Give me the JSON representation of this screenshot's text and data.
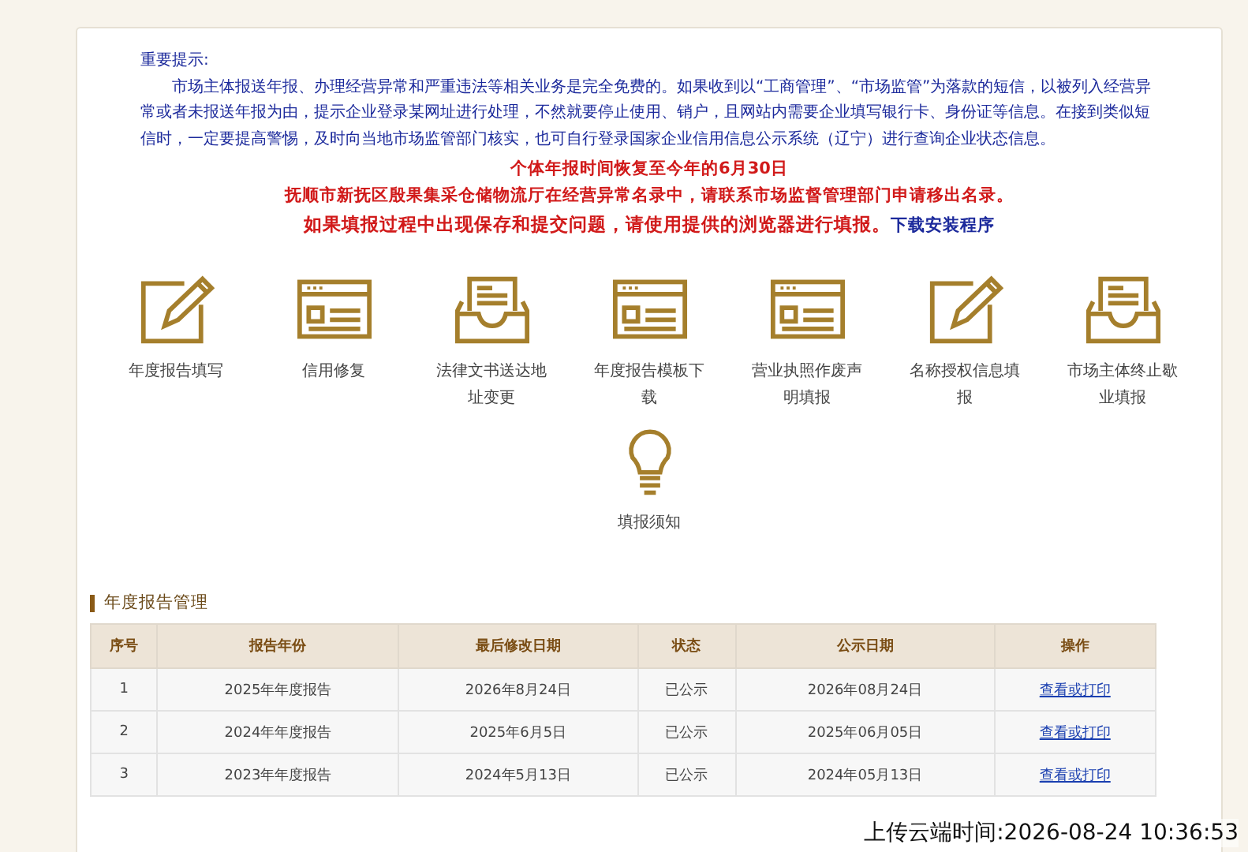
{
  "notice": {
    "heading": "重要提示:",
    "body": "市场主体报送年报、办理经营异常和严重违法等相关业务是完全免费的。如果收到以“工商管理”、“市场监管”为落款的短信，以被列入经营异常或者未报送年报为由，提示企业登录某网址进行处理，不然就要停止使用、销户，且网站内需要企业填写银行卡、身份证等信息。在接到类似短信时，一定要提高警惕，及时向当地市场监管部门核实，也可自行登录国家企业信用信息公示系统（辽宁）进行查询企业状态信息。",
    "alerts": [
      "个体年报时间恢复至今年的6月30日",
      "抚顺市新抚区殷果集采仓储物流厅在经营异常名录中，请联系市场监督管理部门申请移出名录。"
    ],
    "browser_tip": "如果填报过程中出现保存和提交问题，请使用提供的浏览器进行填报。",
    "download_link": "下载安装程序"
  },
  "services": [
    {
      "kind": "edit",
      "label": "年度报告填写"
    },
    {
      "kind": "form",
      "label": "信用修复"
    },
    {
      "kind": "document",
      "label": "法律文书送达地址变更"
    },
    {
      "kind": "form",
      "label": "年度报告模板下载"
    },
    {
      "kind": "form",
      "label": "营业执照作废声明填报"
    },
    {
      "kind": "edit",
      "label": "名称授权信息填报"
    },
    {
      "kind": "document",
      "label": "市场主体终止歇业填报"
    },
    {
      "kind": "guide",
      "label": "填报须知"
    }
  ],
  "section_title": "年度报告管理",
  "table": {
    "columns": [
      "序号",
      "报告年份",
      "最后修改日期",
      "状态",
      "公示日期",
      "操作"
    ],
    "rows": [
      [
        "1",
        "2025年年度报告",
        "2026年8月24日",
        "已公示",
        "2026年08月24日",
        "查看或打印"
      ],
      [
        "2",
        "2024年年度报告",
        "2025年6月5日",
        "已公示",
        "2025年06月05日",
        "查看或打印"
      ],
      [
        "3",
        "2023年年度报告",
        "2024年5月13日",
        "已公示",
        "2024年05月13日",
        "查看或打印"
      ]
    ]
  },
  "upload_stamp": "上传云端时间:2026-08-24 10:36:53"
}
